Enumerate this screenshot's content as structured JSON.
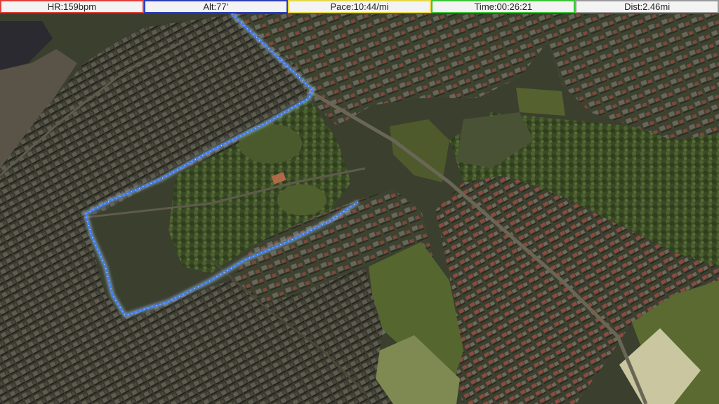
{
  "stats": [
    {
      "label": "HR:159bpm",
      "color": "#e0403c"
    },
    {
      "label": "Alt:77'",
      "color": "#2f3fb8"
    },
    {
      "label": "Pace:10:44/mi",
      "color": "#e5d84a"
    },
    {
      "label": "Time:00:26:21",
      "color": "#3fc43a"
    },
    {
      "label": "Dist:2.46mi",
      "color": "#9a9a9a"
    }
  ],
  "route": {
    "color": "#3d7bff",
    "glow": "#a9d8ff"
  },
  "map": {
    "type": "3d-satellite-city-view"
  }
}
